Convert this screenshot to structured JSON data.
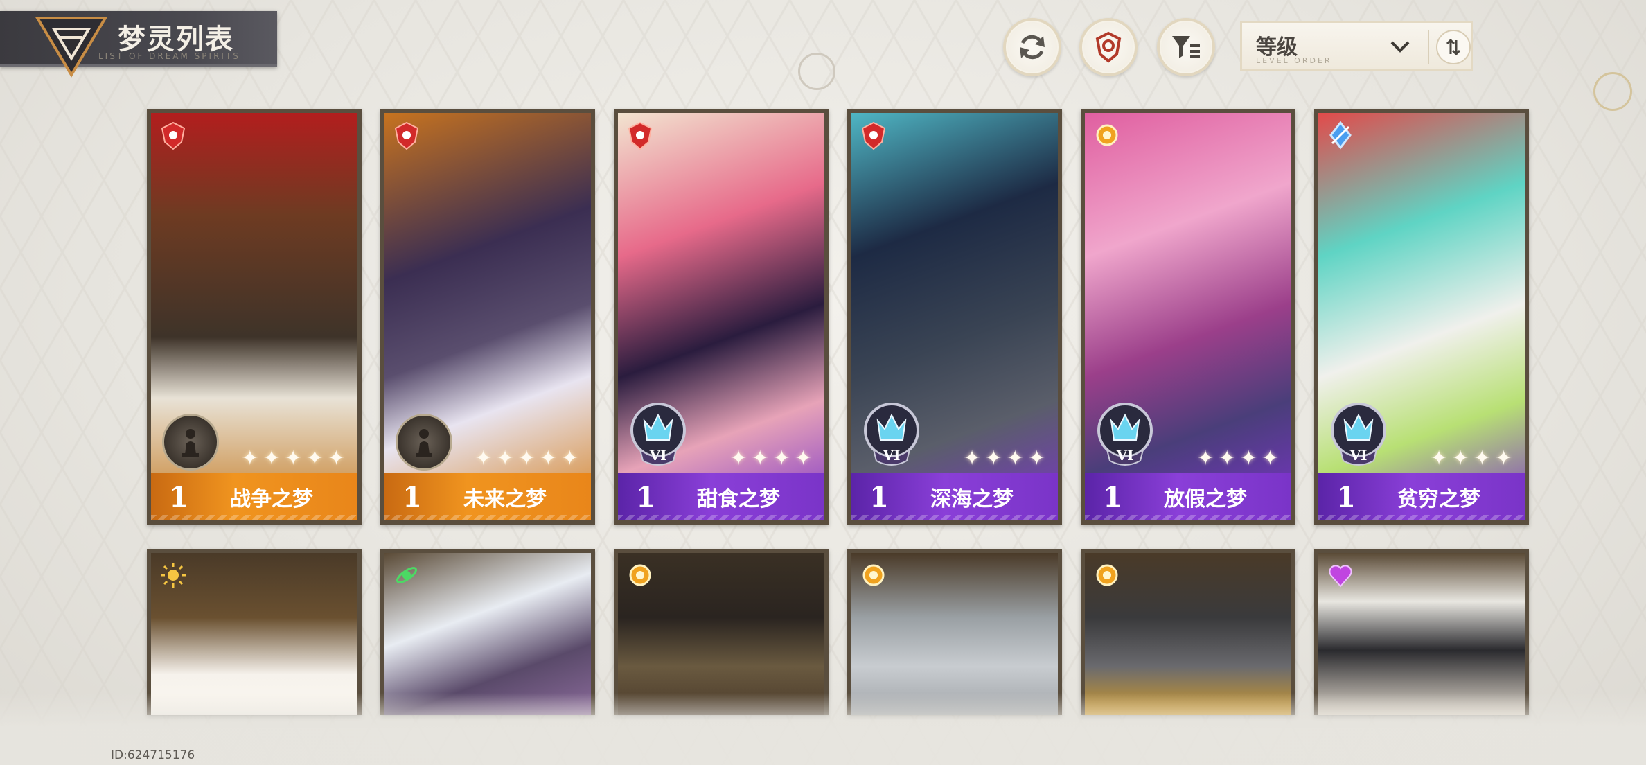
{
  "header": {
    "title": "梦灵列表",
    "subtitle": "LIST OF DREAM SPIRITS"
  },
  "controls": {
    "refresh_icon": "refresh-icon",
    "element_filter_icon": "shield-filter-icon",
    "list_filter_icon": "funnel-list-icon",
    "sort_label": "等级",
    "sort_sub": "LEVEL ORDER"
  },
  "cards_row1": [
    {
      "level": "1",
      "name": "战争之梦",
      "banner": "gold",
      "element": "red-shield",
      "rank": "",
      "pawn": true
    },
    {
      "level": "1",
      "name": "未来之梦",
      "banner": "gold",
      "element": "red-shield",
      "rank": "",
      "pawn": true
    },
    {
      "level": "1",
      "name": "甜食之梦",
      "banner": "violet",
      "element": "red-shield",
      "rank": "VI",
      "pawn": false
    },
    {
      "level": "1",
      "name": "深海之梦",
      "banner": "violet",
      "element": "red-shield",
      "rank": "VI",
      "pawn": false
    },
    {
      "level": "1",
      "name": "放假之梦",
      "banner": "violet",
      "element": "gold-orb",
      "rank": "VI",
      "pawn": false
    },
    {
      "level": "1",
      "name": "贫穷之梦",
      "banner": "violet",
      "element": "blue-crystal",
      "rank": "VI",
      "pawn": false
    }
  ],
  "cards_row2": [
    {
      "element": "sun"
    },
    {
      "element": "green-atom"
    },
    {
      "element": "gold-orb"
    },
    {
      "element": "gold-orb"
    },
    {
      "element": "gold-orb"
    },
    {
      "element": "purple-heart"
    }
  ],
  "footer": {
    "player_id": "ID:624715176"
  },
  "colors": {
    "gold_banner": "#f0941f",
    "violet_banner": "#8a3fd8",
    "card_border": "#5a4e3e"
  }
}
